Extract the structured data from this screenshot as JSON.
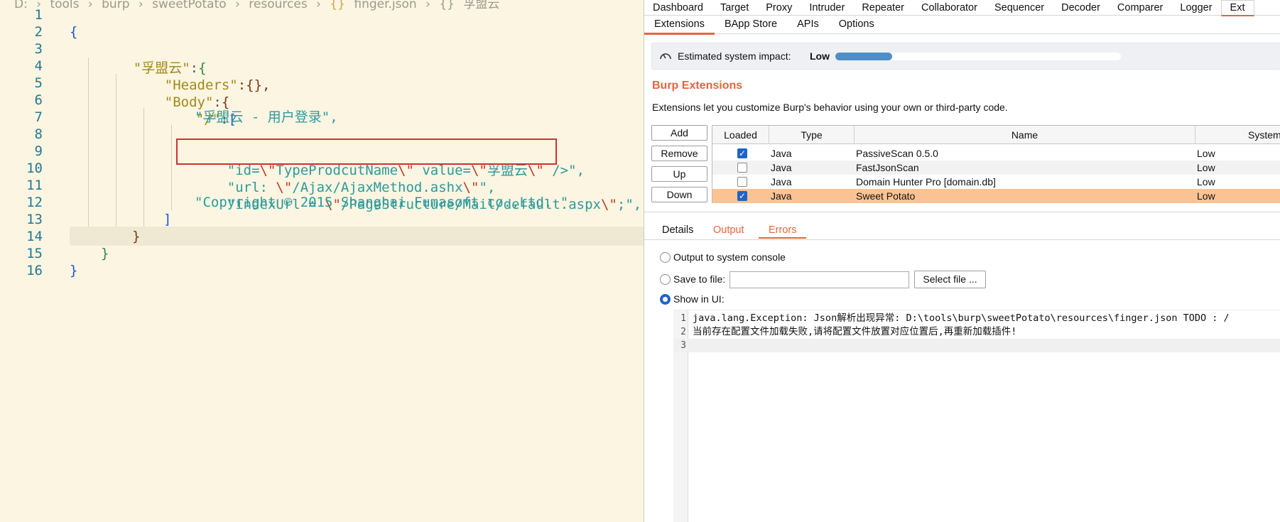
{
  "editor": {
    "breadcrumb": [
      "D:",
      "›",
      "tools",
      "›",
      "burp",
      "›",
      "sweetPotato",
      "›",
      "resources",
      "›",
      "{}",
      "finger.json",
      "›",
      "{}",
      "孚盟云"
    ],
    "line_numbers": [
      "1",
      "2",
      "3",
      "4",
      "5",
      "6",
      "7",
      "8",
      "9",
      "10",
      "11",
      "12",
      "13",
      "14",
      "15",
      "16"
    ],
    "lines": {
      "l2": "{",
      "l3_key": "\"孚盟云\"",
      "l3_colon": ":",
      "l3_brace": "{",
      "l4_key": "\"Headers\"",
      "l4_rest": ":{},",
      "l5_key": "\"Body\"",
      "l5_colon": ":",
      "l5_brace": "{",
      "l6_key": "\"/\"",
      "l6_colon": ":",
      "l6_bracket": "[",
      "l7": "\"孚盟云 - 用户登录\",",
      "l8_a": "\"id=",
      "l8_b": "\\\"",
      "l8_c": "TypeProdcutName",
      "l8_d": "\\\"",
      "l8_e": " value=",
      "l8_f": "\\\"",
      "l8_g": "孚盟云",
      "l8_h": "\\\"",
      "l8_i": " />\",",
      "l9_a": "\"url: ",
      "l9_b": "\\\"",
      "l9_c": "/Ajax/AjaxMethod.ashx",
      "l9_d": "\\\"",
      "l9_e": "\",",
      "l10_a": "\"indexUrl = ",
      "l10_b": "\\\"",
      "l10_c": "/PageStructure/Mail/default.aspx",
      "l10_d": "\\\"",
      "l10_e": ";\",",
      "l11": "\"Copyright © 2015 Shanghai Fumasoft co.,Ltd. \"",
      "l12": "]",
      "l13": "}",
      "l14": "}",
      "l15": "}"
    }
  },
  "burp": {
    "top_tabs": [
      "Dashboard",
      "Target",
      "Proxy",
      "Intruder",
      "Repeater",
      "Collaborator",
      "Sequencer",
      "Decoder",
      "Comparer",
      "Logger",
      "Ext"
    ],
    "active_top_tab": "Ext",
    "sub_tabs": [
      "Extensions",
      "BApp Store",
      "APIs",
      "Options"
    ],
    "active_sub_tab": "Extensions",
    "impact": {
      "label": "Estimated system impact:",
      "value": "Low",
      "level_percent": 20
    },
    "section_title": "Burp Extensions",
    "section_desc": "Extensions let you customize Burp's behavior using your own or third-party code.",
    "buttons": {
      "add": "Add",
      "remove": "Remove",
      "up": "Up",
      "down": "Down"
    },
    "table": {
      "headers": [
        "Loaded",
        "Type",
        "Name",
        "System"
      ],
      "rows": [
        {
          "loaded": true,
          "type": "Java",
          "name": "PassiveScan 0.5.0",
          "system": "Low"
        },
        {
          "loaded": false,
          "type": "Java",
          "name": "FastJsonScan",
          "system": "Low"
        },
        {
          "loaded": false,
          "type": "Java",
          "name": "Domain Hunter Pro [domain.db]",
          "system": "Low"
        },
        {
          "loaded": true,
          "type": "Java",
          "name": "Sweet Potato",
          "system": "Low"
        }
      ]
    },
    "output_tabs": [
      "Details",
      "Output",
      "Errors"
    ],
    "active_output_tab": "Errors",
    "output_options": {
      "console": "Output to system console",
      "save": "Save to file:",
      "save_value": "",
      "select_file": "Select file ...",
      "ui": "Show in UI:"
    },
    "console_lines": [
      {
        "num": "1",
        "text": "java.lang.Exception: Json解析出现异常: D:\\tools\\burp\\sweetPotato\\resources\\finger.json TODO : /"
      },
      {
        "num": "2",
        "text": "当前存在配置文件加载失败,请将配置文件放置对应位置后,再重新加载插件!"
      },
      {
        "num": "3",
        "text": ""
      }
    ]
  }
}
